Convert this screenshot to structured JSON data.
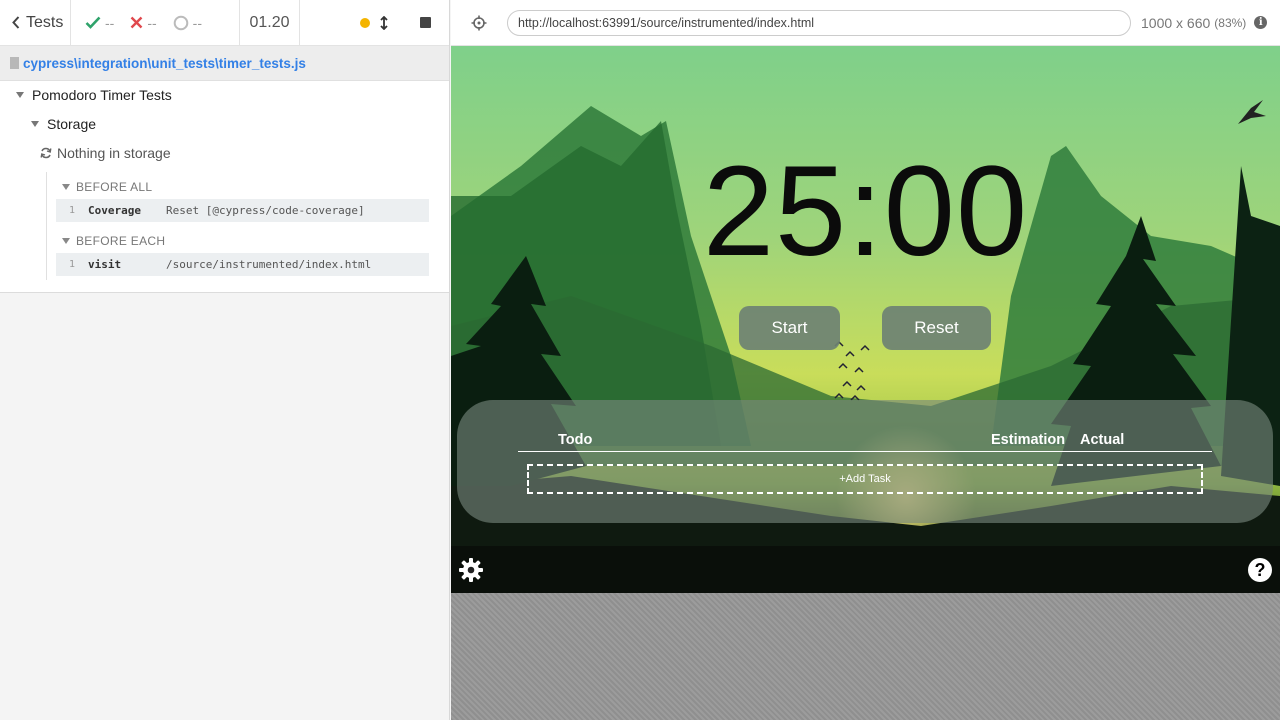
{
  "reporter": {
    "tests_label": "Tests",
    "passed": "--",
    "failed": "--",
    "pending": "--",
    "duration": "01.20",
    "spec_path": "cypress\\integration\\unit_tests\\timer_tests.js",
    "suite": "Pomodoro Timer Tests",
    "subsuite": "Storage",
    "test": "Nothing in storage",
    "hooks": [
      {
        "title": "BEFORE ALL",
        "command": {
          "num": "1",
          "name": "Coverage",
          "message": "Reset [@cypress/code-coverage]"
        }
      },
      {
        "title": "BEFORE EACH",
        "command": {
          "num": "1",
          "name": "visit",
          "message": "/source/instrumented/index.html"
        }
      }
    ]
  },
  "aut": {
    "url": "http://localhost:63991/source/instrumented/index.html",
    "viewport": "1000 x 660",
    "scale": "(83%)"
  },
  "app": {
    "time": "25:00",
    "start_label": "Start",
    "reset_label": "Reset",
    "col_todo": "Todo",
    "col_estimation": "Estimation",
    "col_actual": "Actual",
    "add_task": "+Add Task",
    "help": "?"
  },
  "colors": {
    "accent": "#3380e6",
    "passed": "#2fa36b",
    "failed": "#e0484d",
    "running_dot": "#f4b400"
  }
}
